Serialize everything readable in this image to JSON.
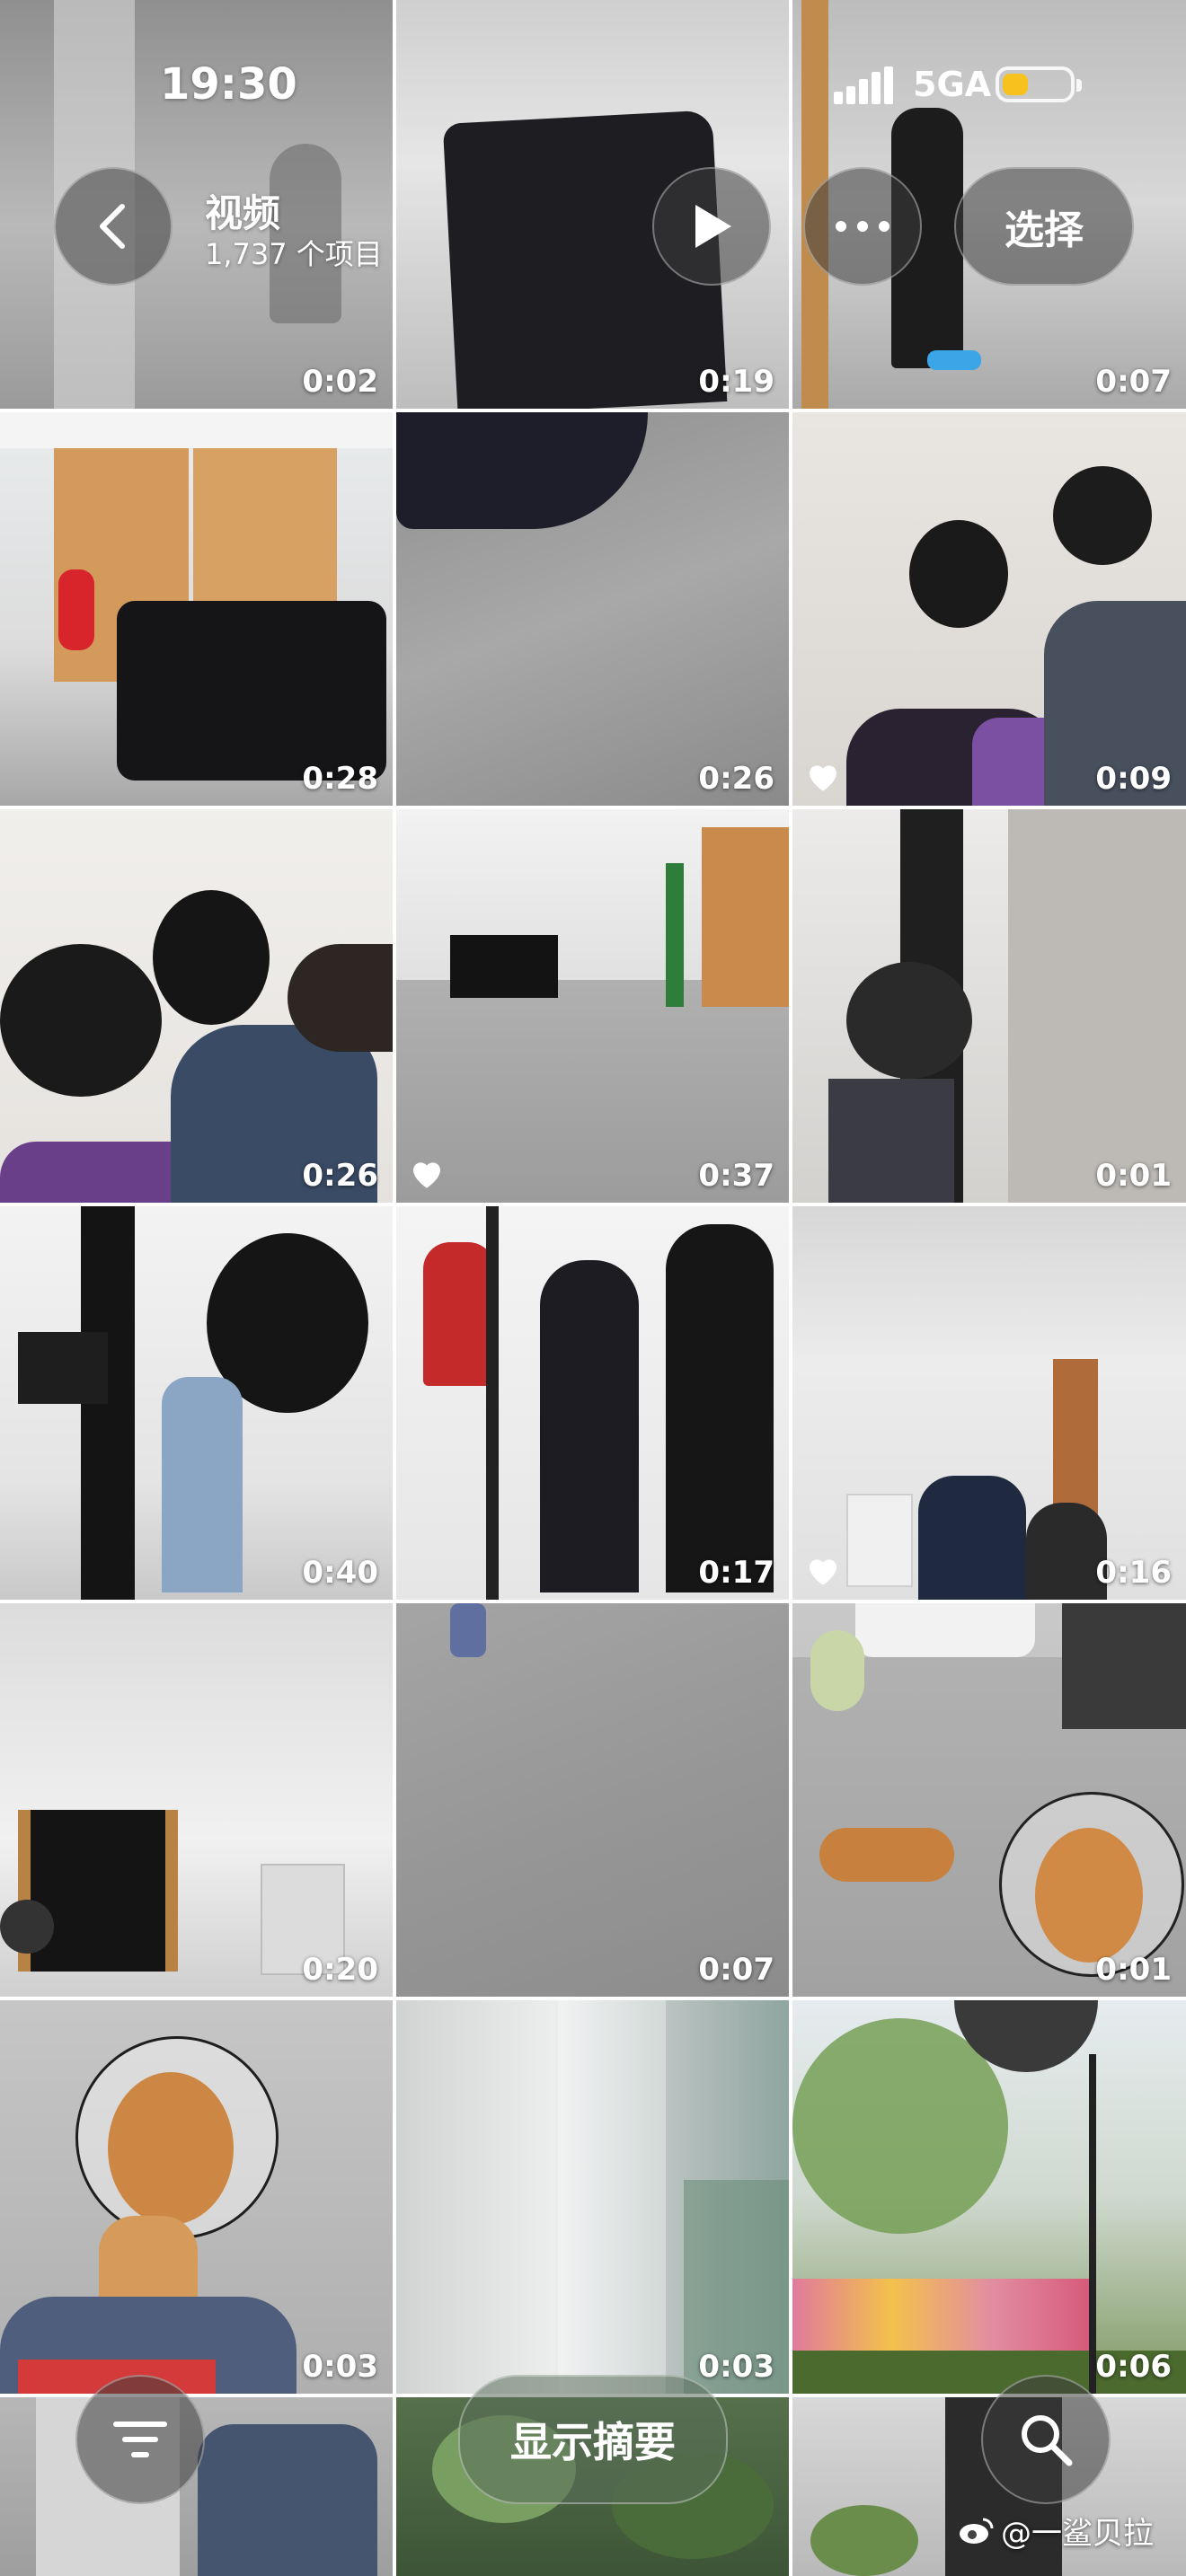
{
  "status_bar": {
    "time": "19:30",
    "network": "5GA",
    "battery_level": 0.45
  },
  "header": {
    "title": "视频",
    "count": "1,737 个项目",
    "back_icon": "chevron-left-icon",
    "play_icon": "play-icon",
    "more_icon": "ellipsis-icon",
    "select_label": "选择"
  },
  "videos": [
    {
      "duration": "0:02",
      "favorite": false
    },
    {
      "duration": "0:19",
      "favorite": false
    },
    {
      "duration": "0:07",
      "favorite": false
    },
    {
      "duration": "0:28",
      "favorite": false
    },
    {
      "duration": "0:26",
      "favorite": false
    },
    {
      "duration": "0:09",
      "favorite": true
    },
    {
      "duration": "0:26",
      "favorite": false
    },
    {
      "duration": "0:37",
      "favorite": true
    },
    {
      "duration": "0:01",
      "favorite": false
    },
    {
      "duration": "0:40",
      "favorite": false
    },
    {
      "duration": "0:17",
      "favorite": false
    },
    {
      "duration": "0:16",
      "favorite": true
    },
    {
      "duration": "0:20",
      "favorite": false
    },
    {
      "duration": "0:07",
      "favorite": false
    },
    {
      "duration": "0:01",
      "favorite": false
    },
    {
      "duration": "0:03",
      "favorite": false
    },
    {
      "duration": "0:03",
      "favorite": false
    },
    {
      "duration": "0:06",
      "favorite": false
    }
  ],
  "bottom_bar": {
    "filter_icon": "filter-lines-icon",
    "summary_label": "显示摘要",
    "search_icon": "search-icon"
  },
  "watermark": {
    "text": "@一鲨贝拉",
    "icon": "weibo-icon"
  },
  "colors": {
    "favorite_heart": "#ffffff",
    "battery": "#f7c21e",
    "overlay_button": "#3c3c3c"
  }
}
